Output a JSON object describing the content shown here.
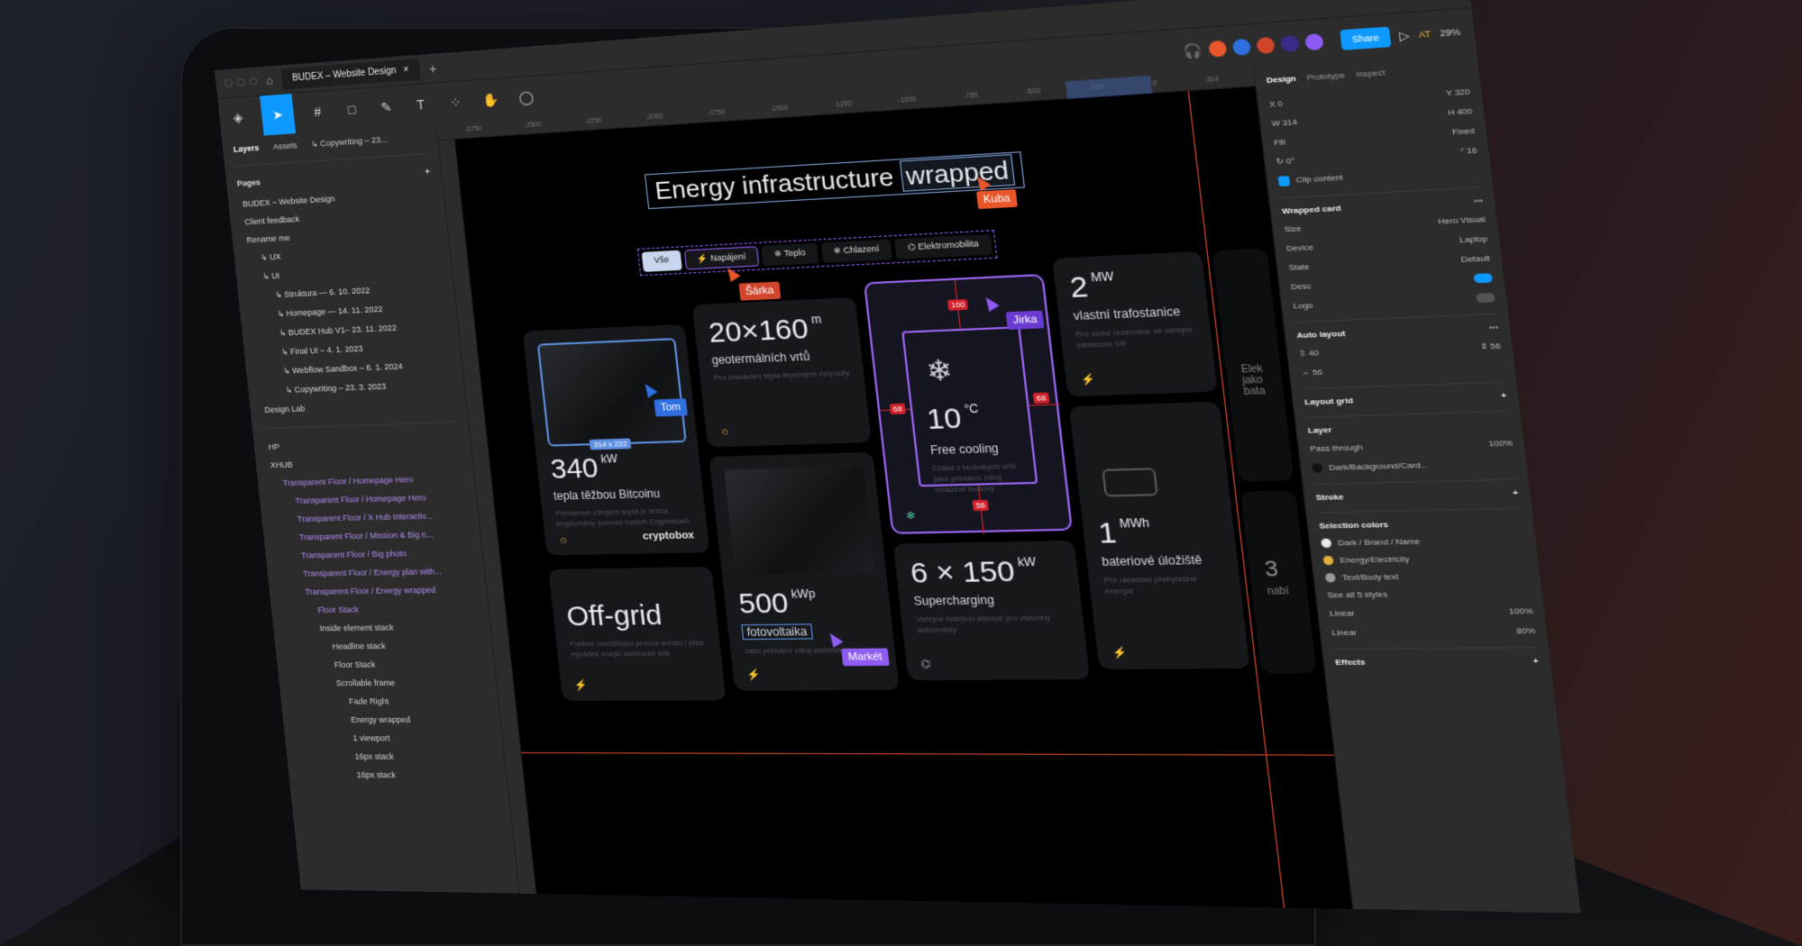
{
  "window": {
    "file_tab": "BUDEX – Website Design",
    "share_label": "Share",
    "zoom": "29%",
    "user_initials": "AT"
  },
  "left_panel": {
    "tabs": [
      "Layers",
      "Assets",
      "↳ Copywriting – 23..."
    ],
    "pages_header": "Pages",
    "pages": [
      {
        "label": "BUDEX – Website Design",
        "indent": 0
      },
      {
        "label": "Client feedback",
        "indent": 0
      },
      {
        "label": "Rename me",
        "indent": 0
      },
      {
        "label": "↳ UX",
        "indent": 1
      },
      {
        "label": "↳ UI",
        "indent": 1
      },
      {
        "label": "↳ Struktura — 6. 10. 2022",
        "indent": 2
      },
      {
        "label": "↳ Homepage — 14. 11. 2022",
        "indent": 2
      },
      {
        "label": "↳ BUDEX Hub  V1– 23. 11. 2022",
        "indent": 2
      },
      {
        "label": "↳ Final UI – 4. 1. 2023",
        "indent": 2
      },
      {
        "label": "↳ Webflow Sandbox – 6. 1. 2024",
        "indent": 2
      },
      {
        "label": "↳ Copywriting – 23. 3. 2023",
        "indent": 2
      },
      {
        "label": "Design Lab",
        "indent": 0
      }
    ],
    "layers": [
      {
        "label": "HP",
        "indent": 0,
        "purple": false
      },
      {
        "label": "XHUB",
        "indent": 0,
        "purple": false
      },
      {
        "label": "Transparent Floor / Homepage Hero",
        "indent": 1,
        "purple": true
      },
      {
        "label": "Transparent Floor / Homepage Hero",
        "indent": 2,
        "purple": true
      },
      {
        "label": "Transparent Floor / X Hub Interactiv...",
        "indent": 2,
        "purple": true
      },
      {
        "label": "Transparent Floor / Mission & Big n...",
        "indent": 2,
        "purple": true
      },
      {
        "label": "Transparent Floor / Big photo",
        "indent": 2,
        "purple": true
      },
      {
        "label": "Transparent Floor / Energy plan with...",
        "indent": 2,
        "purple": true
      },
      {
        "label": "Transparent Floor / Energy wrapped",
        "indent": 2,
        "purple": true
      },
      {
        "label": "Floor Stack",
        "indent": 3,
        "purple": true
      },
      {
        "label": "Inside element stack",
        "indent": 3,
        "purple": false
      },
      {
        "label": "Headline stack",
        "indent": 4,
        "purple": false
      },
      {
        "label": "Floor Stack",
        "indent": 4,
        "purple": false
      },
      {
        "label": "Scrollable frame",
        "indent": 4,
        "purple": false
      },
      {
        "label": "Fade Right",
        "indent": 5,
        "purple": false
      },
      {
        "label": "Energy wrapped",
        "indent": 5,
        "purple": false
      },
      {
        "label": "1 viewport",
        "indent": 5,
        "purple": false
      },
      {
        "label": "16px stack",
        "indent": 5,
        "purple": false
      },
      {
        "label": "16px stack",
        "indent": 5,
        "purple": false
      }
    ]
  },
  "ruler_ticks": [
    "-2750",
    "-2500",
    "-2250",
    "-2000",
    "-1750",
    "-1500",
    "-1250",
    "-1000",
    "-750",
    "-500",
    "-250",
    "0",
    "314",
    "750",
    "1000"
  ],
  "canvas": {
    "headline_main": "Energy infrastructure",
    "headline_highlight": "wrapped",
    "filters": [
      {
        "label": "Vše",
        "selected": true
      },
      {
        "label": "⚡ Napájení",
        "selected": false
      },
      {
        "label": "❄ Teplo",
        "selected": false
      },
      {
        "label": "❄ Chlazení",
        "selected": false
      },
      {
        "label": "⌬ Elektromobilita",
        "selected": false
      }
    ],
    "cursors": {
      "kuba": "Kuba",
      "sarka": "Šárka",
      "tom": "Tom",
      "jirka": "Jirka",
      "market": "Markét"
    },
    "dimension_tag": "314 x 222",
    "cards": {
      "bitcoin": {
        "value": "340",
        "unit": "kW",
        "label": "tepla těžbou Bitcoinu",
        "desc": "Primárním zdrojem tepla je těžba kryptoměny pomocí našich Cryptoboxů",
        "brand": "cryptobox"
      },
      "geo": {
        "value": "20×160",
        "unit": "m",
        "label": "geotermálních vrtů",
        "desc": "Pro získávání tepla tepelnými čerpadly"
      },
      "cooling": {
        "value": "10",
        "unit": "°C",
        "label": "Free cooling",
        "desc": "Chlad z hlubokých vrtů jako primární zdroj chlazení budovy",
        "badges": [
          "100",
          "68",
          "68",
          "56"
        ]
      },
      "trafo": {
        "value": "2",
        "unit": "MW",
        "label": "vlastní trafostanice",
        "desc": "Pro velké rezervace ve veřejné elektrické síti"
      },
      "offgrid": {
        "value": "Off-grid",
        "desc": "Funkce umožňující provoz areálu i přes výpadek vnější elektrické sítě"
      },
      "solar": {
        "value": "500",
        "unit": "kWp",
        "label": "fotovoltaika",
        "desc": "Jako primární zdroj elektrické energie"
      },
      "charging": {
        "value": "6 × 150",
        "unit": "kW",
        "label": "Supercharging",
        "desc": "Veřejné nabíjecí stanice pro všechny automobily"
      },
      "battery": {
        "value": "1",
        "unit": "MWh",
        "label": "bateriové úložiště",
        "desc": "Pro ukládání přebytečné energie"
      },
      "edge1": {
        "label": "Elek jako bata"
      },
      "edge2": {
        "value": "3",
        "label": "nabí"
      }
    }
  },
  "right_panel": {
    "tabs": [
      "Design",
      "Prototype",
      "Inspect"
    ],
    "position": {
      "x": "0",
      "y": "320",
      "w": "314",
      "h": "400"
    },
    "fill_label": "Fill",
    "fixed_label": "Fixed",
    "radius": "16",
    "clip_content": "Clip content",
    "component": "Wrapped card",
    "props": [
      {
        "name": "Size",
        "value": "Hero Visual"
      },
      {
        "name": "Device",
        "value": "Laptop"
      },
      {
        "name": "State",
        "value": "Default"
      }
    ],
    "desc_label": "Desc",
    "logo_label": "Logo",
    "auto_layout": "Auto layout",
    "gap": "40",
    "padding_h": "56",
    "padding_v": "56",
    "layout_grid": "Layout grid",
    "layer_section": "Layer",
    "blend": "Pass through",
    "opacity": "100%",
    "fill_style": "Dark/Background/Card...",
    "stroke": "Stroke",
    "selection_colors": "Selection colors",
    "colors": [
      {
        "name": "Dark / Brand / Name",
        "hex": "#e8e8e8"
      },
      {
        "name": "Energy/Electricity",
        "hex": "#e0b040"
      },
      {
        "name": "Text/Body text",
        "hex": "#9a9a9a"
      }
    ],
    "see_all": "See all 5 styles",
    "linear": [
      {
        "name": "Linear",
        "pct": "100%"
      },
      {
        "name": "Linear",
        "pct": "80%"
      }
    ],
    "effects": "Effects"
  },
  "colors": {
    "accent": "#0d99ff",
    "selection_purple": "#9a64f0",
    "measure_red": "#d0202a",
    "frame_edge": "#d9482b"
  }
}
